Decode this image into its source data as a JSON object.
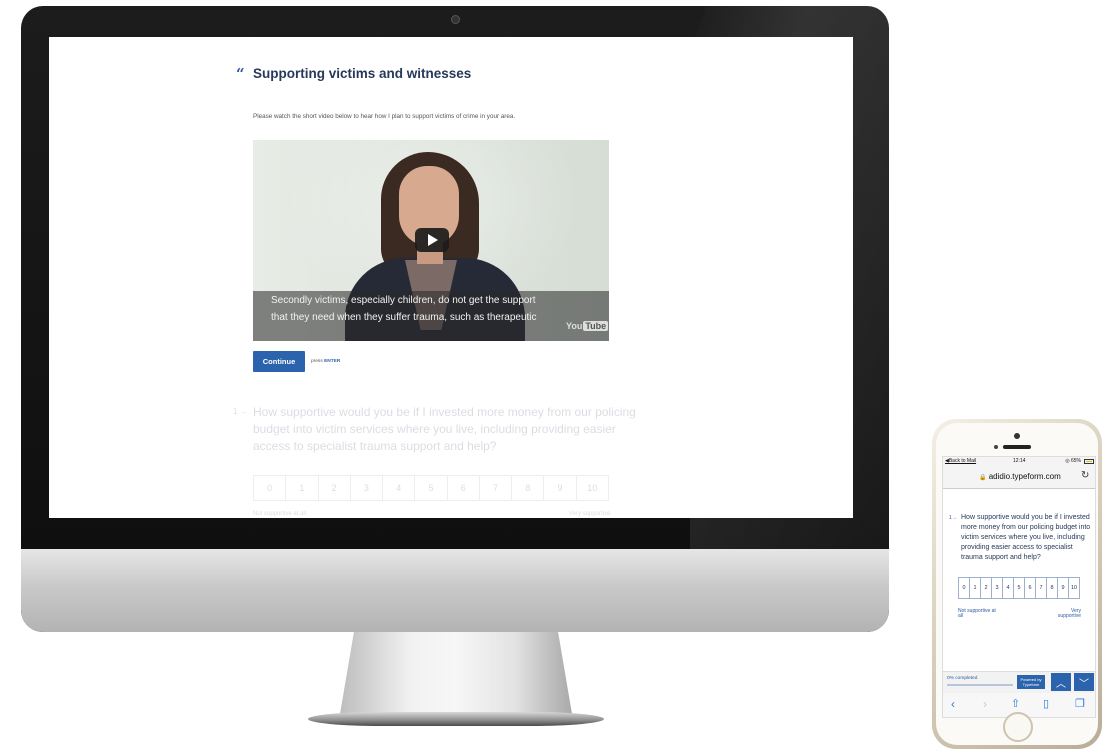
{
  "desktop": {
    "section_title": "Supporting victims and witnesses",
    "description": "Please watch the short video below to hear how I plan to support victims of crime in your area.",
    "video": {
      "caption_line1": "Secondly victims, especially children, do not get the support",
      "caption_line2": "that they need when they suffer trauma, such as therapeutic",
      "logo_text": "You",
      "logo_tube": "Tube"
    },
    "continue_label": "Continue",
    "enter_hint_prefix": "press ",
    "enter_hint_key": "ENTER",
    "question": {
      "number": "1 →",
      "text": "How supportive would you be if I invested more money from our policing budget into victim services where you live, including providing easier access to specialist trauma support and help?",
      "scale": [
        "0",
        "1",
        "2",
        "3",
        "4",
        "5",
        "6",
        "7",
        "8",
        "9",
        "10"
      ],
      "low_label": "Not supportive at all",
      "high_label": "Very supportive"
    }
  },
  "phone": {
    "status": {
      "back": "◀Back to Mail",
      "time": "12:14",
      "battery": "◎ 65%"
    },
    "url": "adidio.typeform.com",
    "question": {
      "number": "1→",
      "text": "How supportive would you be if I invested more money from our policing budget into victim services where you live, including providing easier access to specialist trauma support and help?",
      "scale": [
        "0",
        "1",
        "2",
        "3",
        "4",
        "5",
        "6",
        "7",
        "8",
        "9",
        "10"
      ],
      "low_label": "Not supportive at all",
      "high_label": "Very supportive"
    },
    "progress_text": "0% completed",
    "progress_fraction": 0,
    "powered_by": "Powered by Typeform",
    "accent": "#2b63ad"
  }
}
